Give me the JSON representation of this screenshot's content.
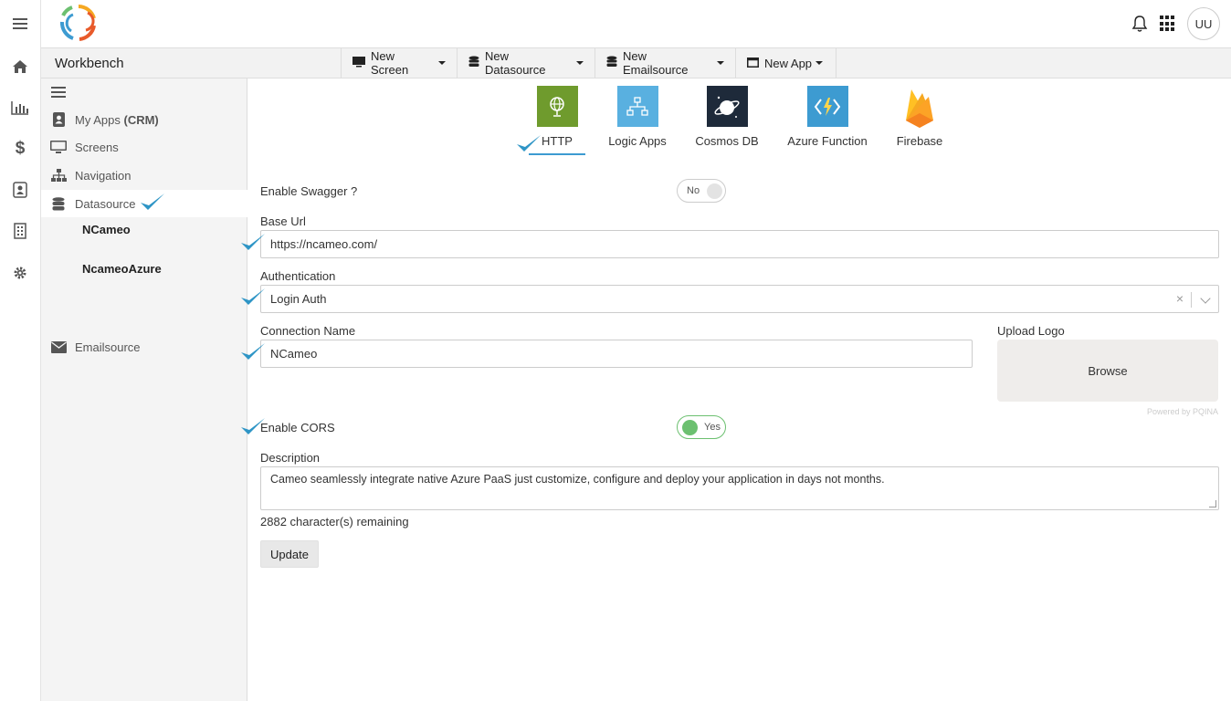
{
  "header": {
    "avatar_initials": "UU"
  },
  "rail": {
    "icons": [
      "menu-icon",
      "home-icon",
      "bar-chart-icon",
      "dollar-icon",
      "contact-card-icon",
      "building-icon",
      "gear-icon"
    ]
  },
  "subbar": {
    "title": "Workbench",
    "buttons": [
      {
        "label": "New Screen",
        "icon": "monitor-icon"
      },
      {
        "label": "New Datasource",
        "icon": "database-icon"
      },
      {
        "label": "New Emailsource",
        "icon": "database-icon"
      },
      {
        "label": "New App",
        "icon": "window-icon"
      }
    ]
  },
  "sidebar": {
    "my_apps": "My Apps",
    "my_apps_tag": "(CRM)",
    "screens": "Screens",
    "navigation": "Navigation",
    "datasource": "Datasource",
    "datasource_items": [
      "NCameo",
      "NcameoAzure"
    ],
    "emailsource": "Emailsource"
  },
  "datasource_types": [
    {
      "label": "HTTP",
      "selected": true,
      "color": "#6f9b2d"
    },
    {
      "label": "Logic Apps",
      "selected": false,
      "color": "#59b0e0"
    },
    {
      "label": "Cosmos DB",
      "selected": false,
      "color": "#1e2a3a"
    },
    {
      "label": "Azure Function",
      "selected": false,
      "color": "#3d9bd1"
    },
    {
      "label": "Firebase",
      "selected": false,
      "color": "#f6a821"
    }
  ],
  "form": {
    "enable_swagger_label": "Enable Swagger ?",
    "swagger_toggle": "No",
    "base_url_label": "Base Url",
    "base_url_value": "https://ncameo.com/",
    "auth_label": "Authentication",
    "auth_value": "Login Auth",
    "auth_clear": "×",
    "connection_name_label": "Connection Name",
    "connection_name_value": "NCameo",
    "upload_logo_label": "Upload Logo",
    "browse_label": "Browse",
    "powered_by": "Powered by PQINA",
    "enable_cors_label": "Enable CORS",
    "cors_toggle": "Yes",
    "description_label": "Description",
    "description_value": "Cameo seamlessly integrate native Azure PaaS just customize, configure and deploy your application in days not months.",
    "remaining": "2882 character(s) remaining",
    "update_label": "Update"
  },
  "colors": {
    "accent": "#3d9bd1",
    "toggle_on": "#6cc070",
    "sidebar_bg": "#f4f4f4"
  }
}
